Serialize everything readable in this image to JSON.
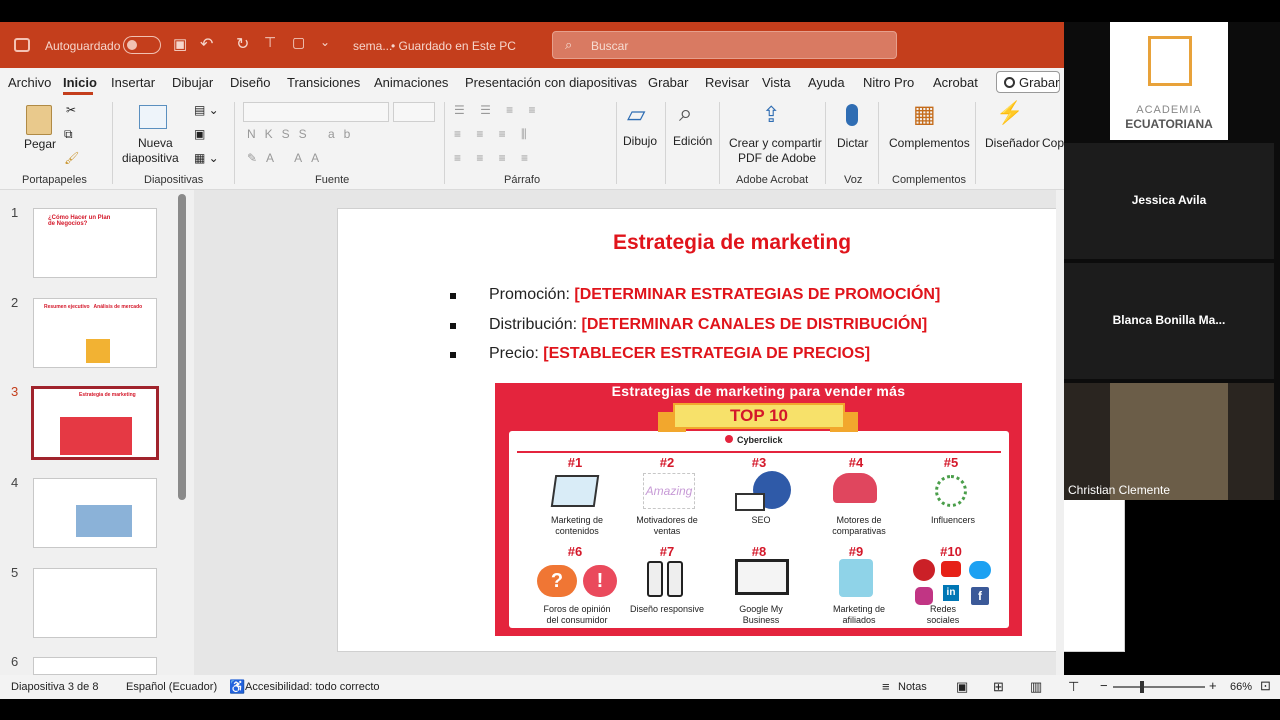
{
  "titlebar": {
    "autosave": "Autoguardado",
    "filename": "sema...",
    "saved": "• Guardado en Este PC",
    "search_placeholder": "Buscar"
  },
  "tabs": [
    "Archivo",
    "Inicio",
    "Insertar",
    "Dibujar",
    "Diseño",
    "Transiciones",
    "Animaciones",
    "Presentación con diapositivas",
    "Grabar",
    "Revisar",
    "Vista",
    "Ayuda",
    "Nitro Pro",
    "Acrobat"
  ],
  "record_button": "Grabar",
  "ribbon": {
    "pegar": "Pegar",
    "nueva": "Nueva",
    "diapositiva": "diapositiva",
    "dibujo": "Dibujo",
    "edicion": "Edición",
    "crear": "Crear y compartir",
    "pdf": "PDF de Adobe",
    "dictar": "Dictar",
    "complementos": "Complementos",
    "disenador": "Diseñador",
    "copilot": "Copilo",
    "groups": {
      "portapapeles": "Portapapeles",
      "diapositivas": "Diapositivas",
      "fuente": "Fuente",
      "parrafo": "Párrafo",
      "adobe": "Adobe Acrobat",
      "voz": "Voz",
      "complementos": "Complementos"
    }
  },
  "thumbnails": [
    {
      "num": "1",
      "title": "¿Cómo Hacer un Plan de Negocios?"
    },
    {
      "num": "2",
      "title": "Resumen ejecutivo   Análisis de mercado"
    },
    {
      "num": "3",
      "title": "Estrategia de marketing"
    },
    {
      "num": "4",
      "title": ""
    },
    {
      "num": "5",
      "title": ""
    },
    {
      "num": "6",
      "title": ""
    }
  ],
  "slide": {
    "title": "Estrategia de marketing",
    "bullets": [
      {
        "label": "Promoción: ",
        "value": "[DETERMINAR ESTRATEGIAS DE PROMOCIÓN]"
      },
      {
        "label": "Distribución: ",
        "value": "[DETERMINAR CANALES DE DISTRIBUCIÓN]"
      },
      {
        "label": "Precio: ",
        "value": "[ESTABLECER ESTRATEGIA DE PRECIOS]"
      }
    ],
    "infographic": {
      "header": "Estrategias de marketing para vender más",
      "banner": "TOP 10",
      "brand": "Cyberclick",
      "items": [
        {
          "n": "#1",
          "label": "Marketing de contenidos"
        },
        {
          "n": "#2",
          "label": "Motivadores de ventas"
        },
        {
          "n": "#3",
          "label": "SEO"
        },
        {
          "n": "#4",
          "label": "Motores de comparativas"
        },
        {
          "n": "#5",
          "label": "Influencers"
        },
        {
          "n": "#6",
          "label": "Foros de opinión del consumidor"
        },
        {
          "n": "#7",
          "label": "Diseño responsive"
        },
        {
          "n": "#8",
          "label": "Google My Business"
        },
        {
          "n": "#9",
          "label": "Marketing de afiliados"
        },
        {
          "n": "#10",
          "label": "Redes sociales"
        }
      ]
    }
  },
  "status": {
    "slide": "Diapositiva 3 de 8",
    "language": "Español (Ecuador)",
    "accessibility": "Accesibilidad: todo correcto",
    "notes": "Notas",
    "zoom": "66%"
  },
  "video": {
    "logo_line1": "ACADEMIA",
    "logo_line2": "ECUATORIANA",
    "participants": [
      "Jessica Avila",
      "Blanca  Bonilla  Ma...",
      "Christian Clemente"
    ]
  }
}
